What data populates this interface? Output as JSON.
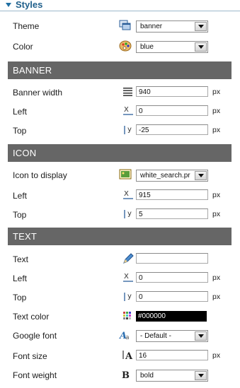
{
  "section_title": "Styles",
  "rows": {
    "theme": {
      "label": "Theme",
      "value": "banner"
    },
    "color": {
      "label": "Color",
      "value": "blue"
    }
  },
  "banner": {
    "heading": "BANNER",
    "width_label": "Banner width",
    "width_value": "940",
    "width_unit": "px",
    "left_label": "Left",
    "left_value": "0",
    "left_unit": "px",
    "top_label": "Top",
    "top_value": "-25",
    "top_unit": "px"
  },
  "icon": {
    "heading": "ICON",
    "display_label": "Icon to display",
    "display_value": "white_search.pr",
    "left_label": "Left",
    "left_value": "915",
    "left_unit": "px",
    "top_label": "Top",
    "top_value": "5",
    "top_unit": "px"
  },
  "text": {
    "heading": "TEXT",
    "text_label": "Text",
    "text_value": "",
    "left_label": "Left",
    "left_value": "0",
    "left_unit": "px",
    "top_label": "Top",
    "top_value": "0",
    "top_unit": "px",
    "color_label": "Text color",
    "color_value": "#000000",
    "font_label": "Google font",
    "font_value": "- Default -",
    "size_label": "Font size",
    "size_value": "16",
    "size_unit": "px",
    "weight_label": "Font weight",
    "weight_value": "bold"
  },
  "icons": {
    "theme": "theme-windows-icon",
    "color": "palette-icon",
    "width": "width-lines-icon",
    "x": "x-axis-icon",
    "y": "y-axis-icon",
    "image": "image-icon",
    "text": "pencil-icon",
    "textcolor": "color-grid-icon",
    "font": "font-icon",
    "fontsize": "font-size-icon",
    "bold": "bold-icon"
  },
  "colors": {
    "section_bg": "#666666",
    "accent": "#1f5f8b"
  }
}
